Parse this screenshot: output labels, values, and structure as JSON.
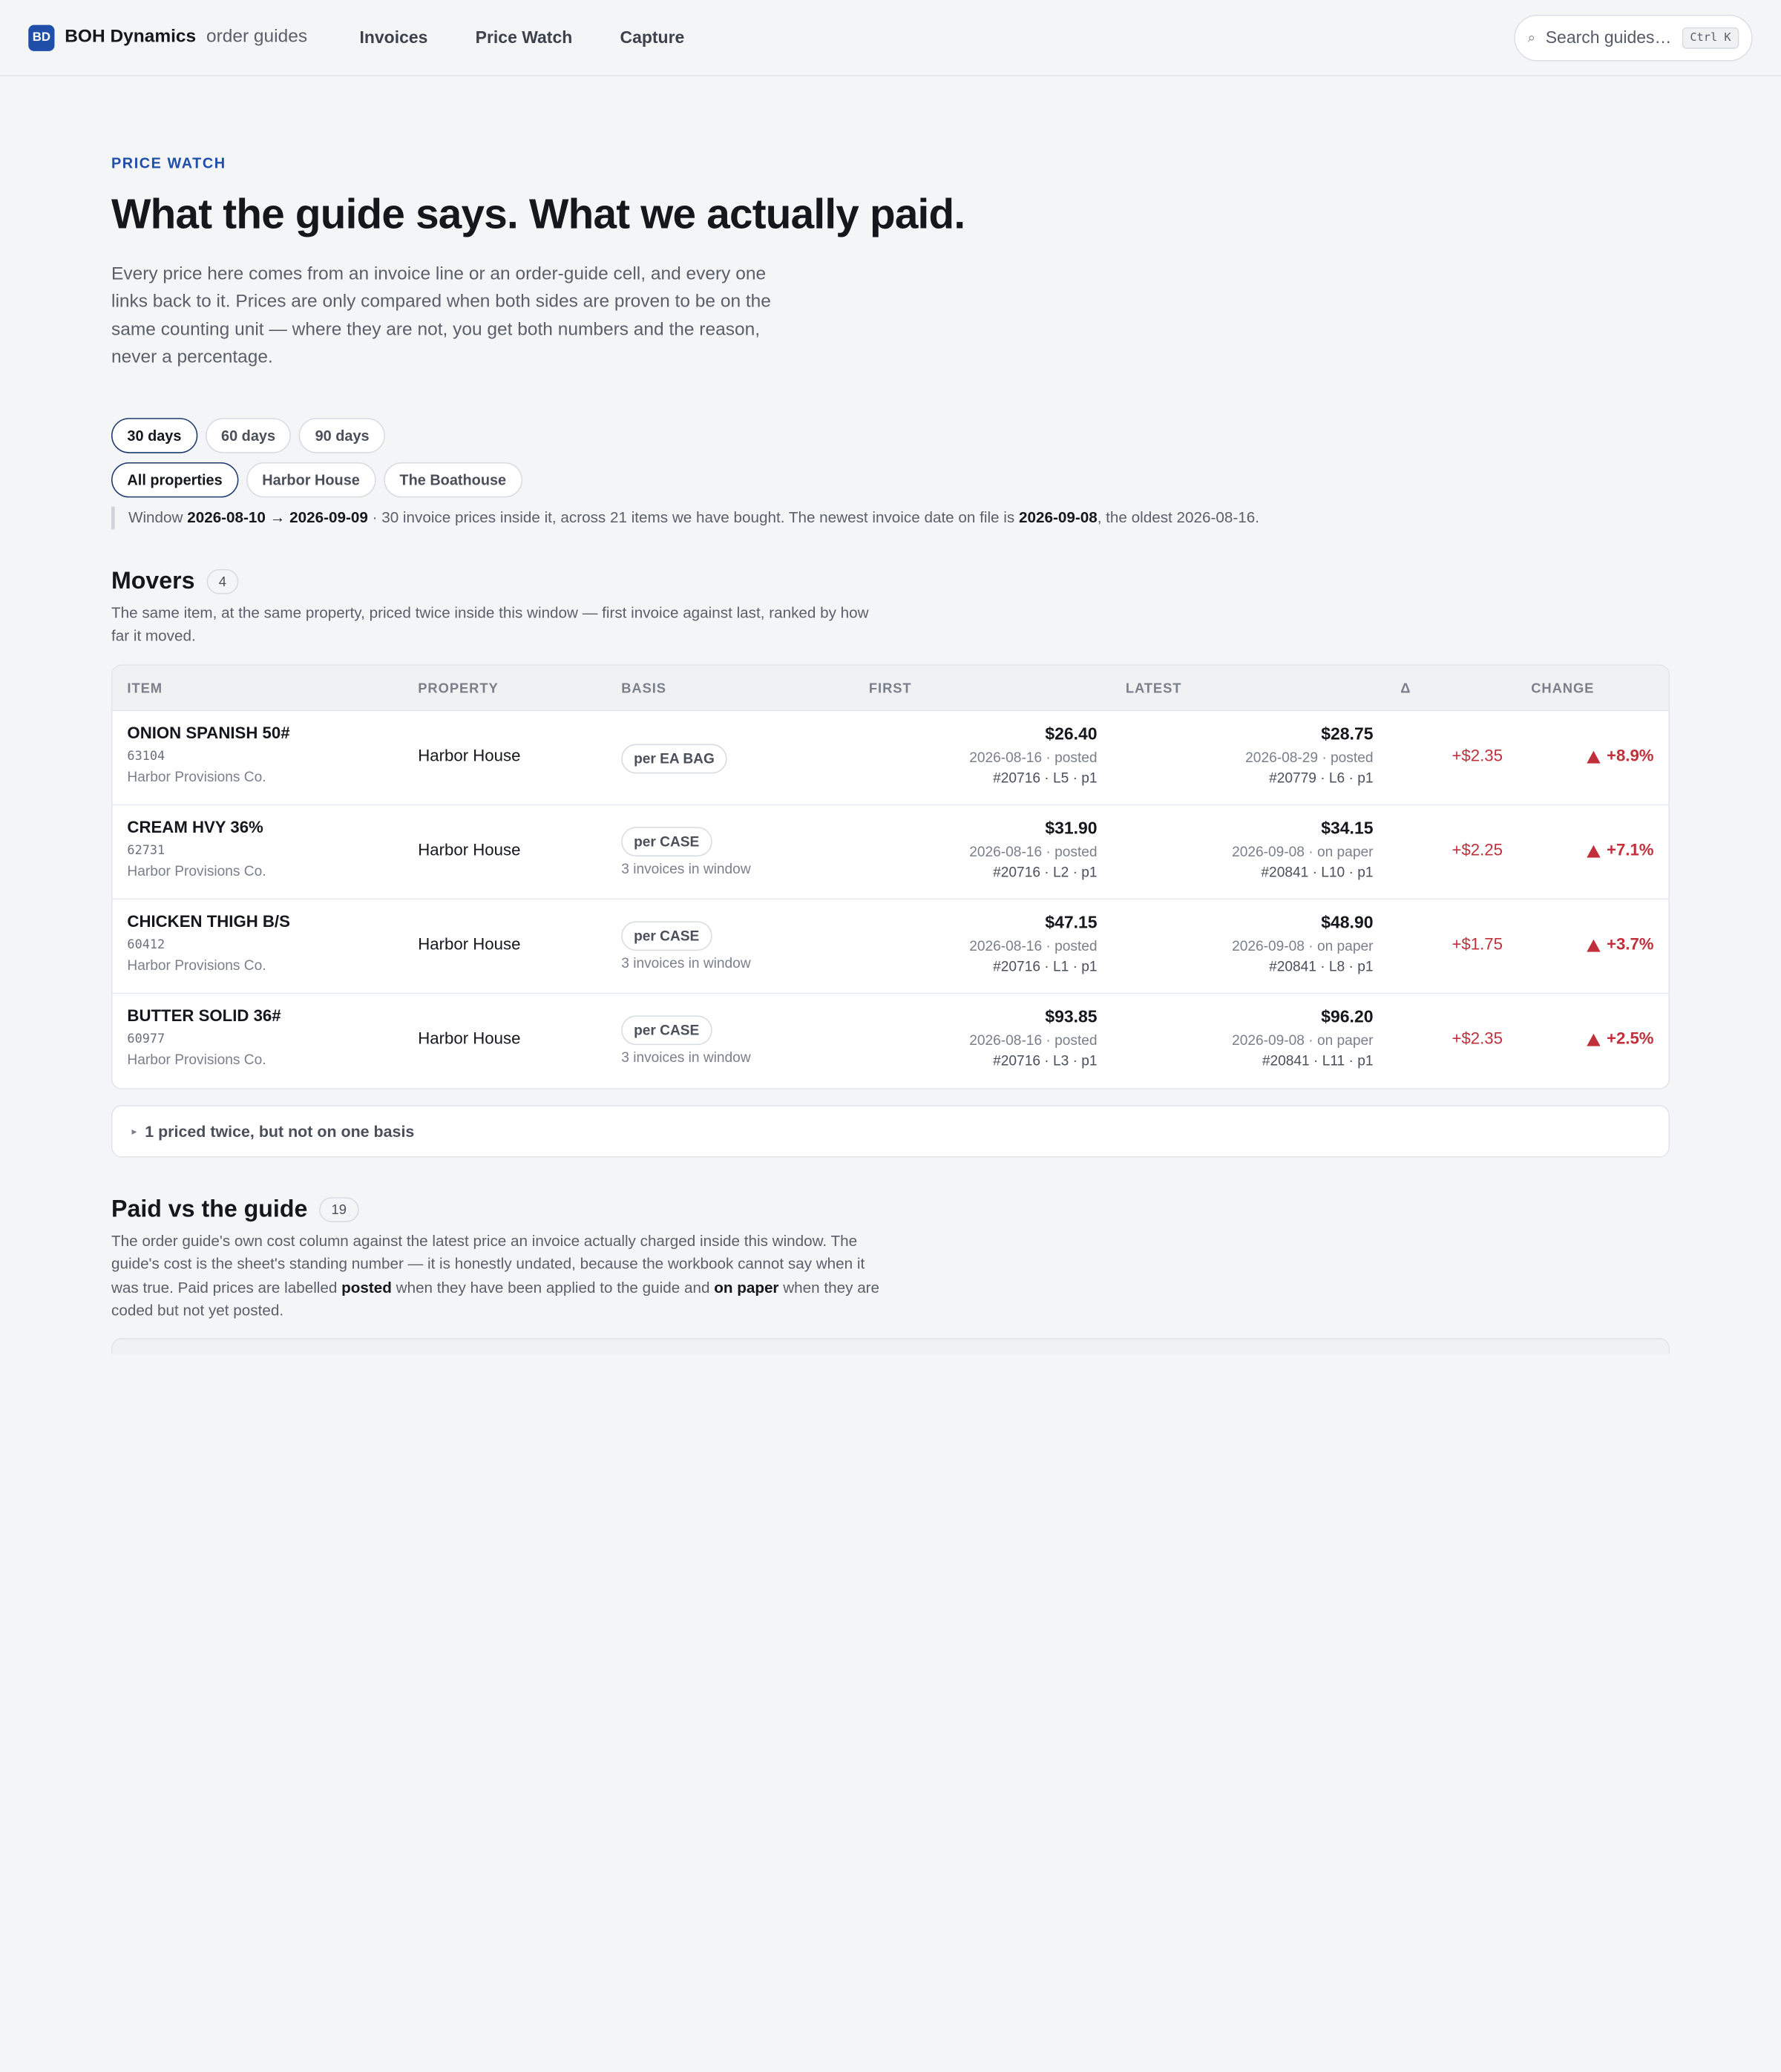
{
  "app": {
    "logo_text": "BD",
    "brand": "BOH Dynamics",
    "section": "order guides"
  },
  "nav": [
    "Invoices",
    "Price Watch",
    "Capture"
  ],
  "search": {
    "placeholder": "Search guides…",
    "shortcut": "Ctrl K"
  },
  "page": {
    "eyebrow": "PRICE WATCH",
    "title": "What the guide says. What we actually paid.",
    "lede": "Every price here comes from an invoice line or an order-guide cell, and every one links back to it. Prices are only compared when both sides are proven to be on the same counting unit — where they are not, you get both numbers and the reason, never a percentage."
  },
  "filters": {
    "days": [
      {
        "label": "30 days",
        "active": true
      },
      {
        "label": "60 days",
        "active": false
      },
      {
        "label": "90 days",
        "active": false
      }
    ],
    "properties": [
      {
        "label": "All properties",
        "active": true
      },
      {
        "label": "Harbor House",
        "active": false
      },
      {
        "label": "The Boathouse",
        "active": false
      }
    ]
  },
  "window": {
    "prefix": "Window",
    "start": "2026-08-10",
    "arrow": "→",
    "end": "2026-09-09",
    "mid": "· 30 invoice prices inside it, across 21 items we have bought. The newest invoice date on file is",
    "newest": "2026-09-08",
    "suffix": ", the oldest 2026-08-16."
  },
  "movers": {
    "title": "Movers",
    "count": "4",
    "desc": "The same item, at the same property, priced twice inside this window — first invoice against last, ranked by how far it moved.",
    "columns": {
      "item": "ITEM",
      "property": "PROPERTY",
      "basis": "BASIS",
      "first": "FIRST",
      "latest": "LATEST",
      "delta": "Δ",
      "change": "CHANGE"
    },
    "rows": [
      {
        "name": "ONION SPANISH 50#",
        "code": "63104",
        "vendor": "Harbor Provisions Co.",
        "property": "Harbor House",
        "basis": "per EA BAG",
        "basis_note": "",
        "first_price": "$26.40",
        "first_meta": "2026-08-16 · posted",
        "first_ref": "#20716 · L5 · p1",
        "latest_price": "$28.75",
        "latest_meta": "2026-08-29 · posted",
        "latest_ref": "#20779 · L6 · p1",
        "delta": "+$2.35",
        "change": "+8.9%"
      },
      {
        "name": "CREAM HVY 36%",
        "code": "62731",
        "vendor": "Harbor Provisions Co.",
        "property": "Harbor House",
        "basis": "per CASE",
        "basis_note": "3 invoices in window",
        "first_price": "$31.90",
        "first_meta": "2026-08-16 · posted",
        "first_ref": "#20716 · L2 · p1",
        "latest_price": "$34.15",
        "latest_meta": "2026-09-08 · on paper",
        "latest_ref": "#20841 · L10 · p1",
        "delta": "+$2.25",
        "change": "+7.1%"
      },
      {
        "name": "CHICKEN THIGH B/S",
        "code": "60412",
        "vendor": "Harbor Provisions Co.",
        "property": "Harbor House",
        "basis": "per CASE",
        "basis_note": "3 invoices in window",
        "first_price": "$47.15",
        "first_meta": "2026-08-16 · posted",
        "first_ref": "#20716 · L1 · p1",
        "latest_price": "$48.90",
        "latest_meta": "2026-09-08 · on paper",
        "latest_ref": "#20841 · L8 · p1",
        "delta": "+$1.75",
        "change": "+3.7%"
      },
      {
        "name": "BUTTER SOLID 36#",
        "code": "60977",
        "vendor": "Harbor Provisions Co.",
        "property": "Harbor House",
        "basis": "per CASE",
        "basis_note": "3 invoices in window",
        "first_price": "$93.85",
        "first_meta": "2026-08-16 · posted",
        "first_ref": "#20716 · L3 · p1",
        "latest_price": "$96.20",
        "latest_meta": "2026-09-08 · on paper",
        "latest_ref": "#20841 · L11 · p1",
        "delta": "+$2.35",
        "change": "+2.5%"
      }
    ],
    "not_one_basis": "1 priced twice, but not on one basis"
  },
  "guide": {
    "title": "Paid vs the guide",
    "count": "19",
    "desc_a": "The order guide's own cost column against the latest price an invoice actually charged inside this window. The guide's cost is the sheet's standing number — it is honestly undated, because the workbook cannot say when it was true. Paid prices are labelled",
    "desc_posted": "posted",
    "desc_b": "when they have been applied to the guide and",
    "desc_onpaper": "on paper",
    "desc_c": "when they are coded but not yet posted."
  },
  "colors": {
    "accent": "#1f4fa8",
    "increase": "#c0303a"
  }
}
